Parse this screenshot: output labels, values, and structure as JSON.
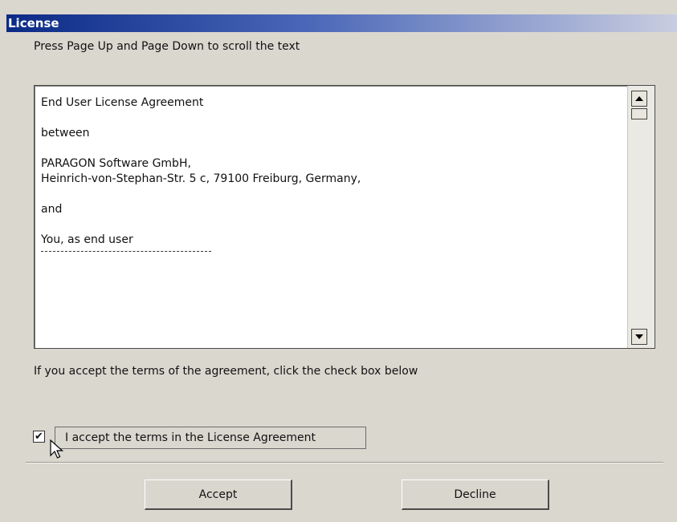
{
  "window": {
    "title": "License"
  },
  "instructions": "Press Page Up and Page Down to scroll the text",
  "license_text": {
    "line1": "End User License Agreement",
    "line2": "between",
    "line3": "PARAGON Software GmbH,",
    "line4": "Heinrich-von-Stephan-Str. 5 c, 79100 Freiburg, Germany,",
    "line5": "and",
    "line6": "You, as end user"
  },
  "accept_hint": "If you accept the terms of the agreement, click the check box below",
  "checkbox": {
    "label": "I accept the terms in the License Agreement",
    "checked": true,
    "mark": "✔"
  },
  "buttons": {
    "accept": "Accept",
    "decline": "Decline"
  },
  "icons": {
    "scroll_up": "scroll-up-arrow-icon",
    "scroll_down": "scroll-down-arrow-icon",
    "cursor": "mouse-pointer-icon"
  }
}
